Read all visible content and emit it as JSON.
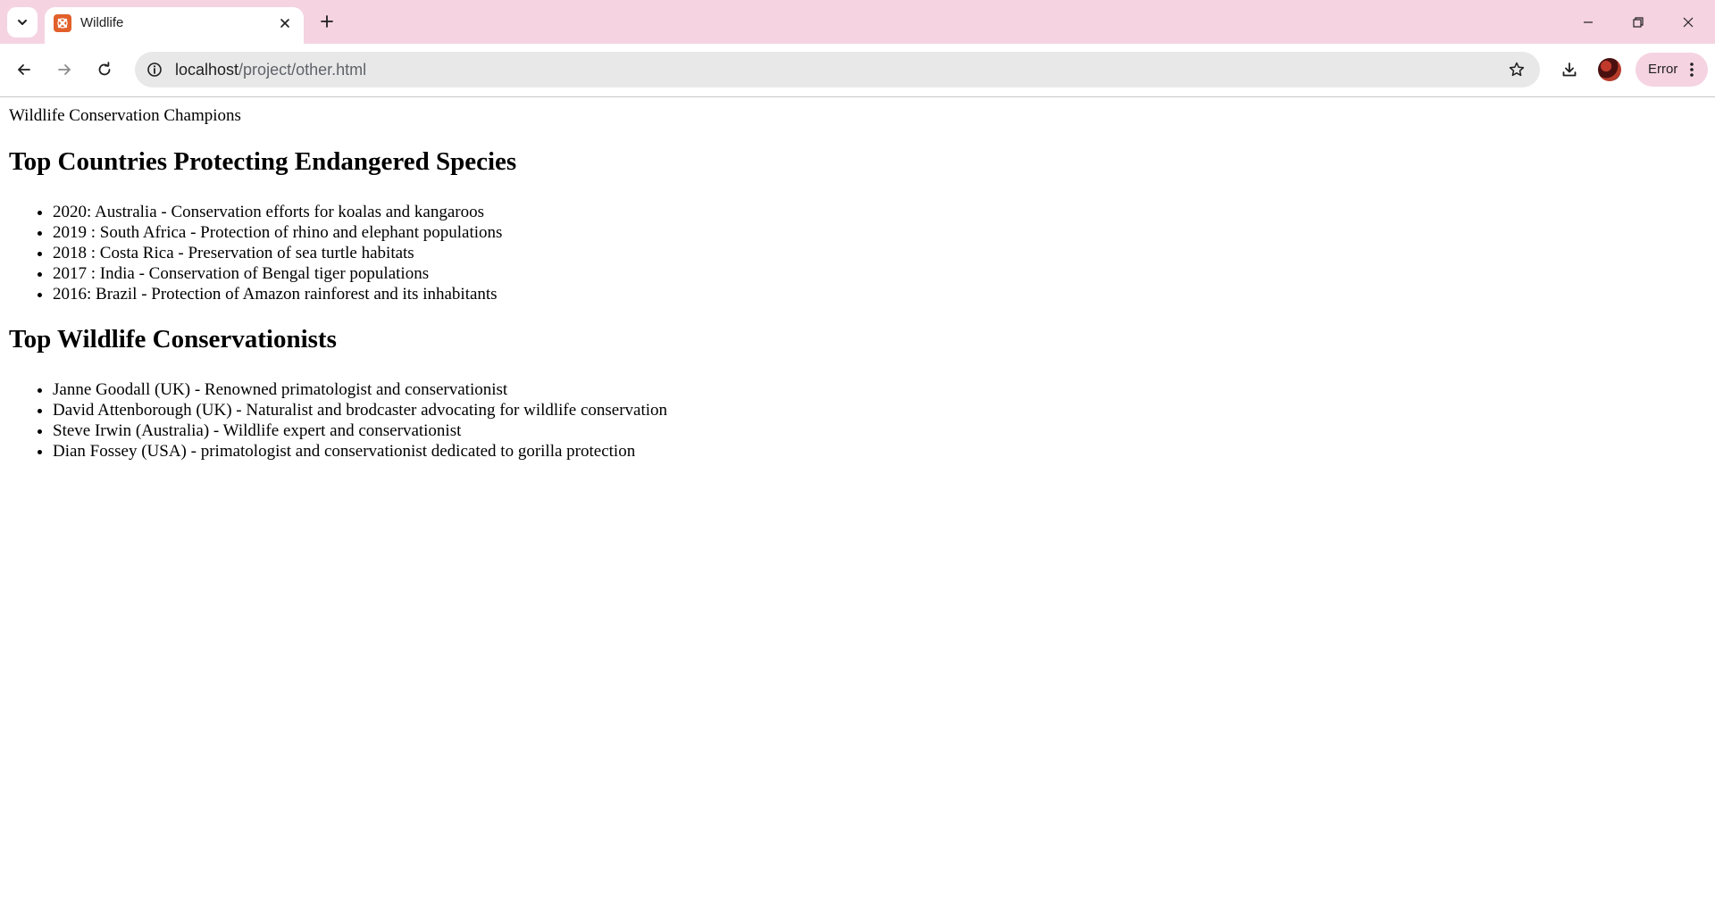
{
  "browser": {
    "tab_title": "Wildlife",
    "url_host": "localhost",
    "url_path": "/project/other.html",
    "profile_status": "Error",
    "accent_color": "#f5d3e1"
  },
  "page": {
    "intro": "Wildlife Conservation Champions",
    "countries_heading": "Top Countries Protecting Endangered Species",
    "countries": [
      "2020: Australia - Conservation efforts for koalas and kangaroos",
      "2019 : South Africa - Protection of rhino and elephant populations",
      "2018 : Costa Rica - Preservation of sea turtle habitats",
      "2017 : India - Conservation of Bengal tiger populations",
      "2016: Brazil - Protection of Amazon rainforest and its inhabitants"
    ],
    "conservationists_heading": "Top Wildlife Conservationists",
    "conservationists": [
      "Janne Goodall (UK) - Renowned primatologist and conservationist",
      "David Attenborough (UK) - Naturalist and brodcaster advocating for wildlife conservation",
      "Steve Irwin (Australia) - Wildlife expert and conservationist",
      "Dian Fossey (USA) - primatologist and conservationist dedicated to gorilla protection"
    ]
  }
}
